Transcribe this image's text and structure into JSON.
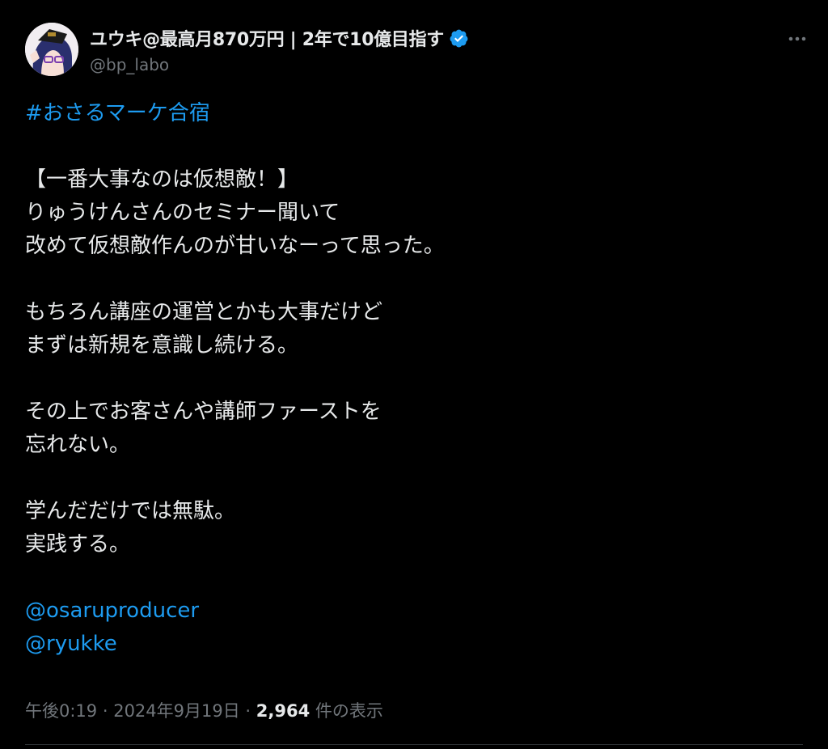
{
  "author": {
    "display_name": "ユウキ@最高月870万円 | 2年で10億目指す",
    "handle": "@bp_labo",
    "verified_icon": "verified-badge-icon",
    "verified_color": "#1d9bf0"
  },
  "menu": {
    "more_icon": "more-options-icon"
  },
  "tweet": {
    "hashtag": "#おさるマーケ合宿",
    "lines": [
      "【一番大事なのは仮想敵！】",
      "りゅうけんさんのセミナー聞いて",
      "改めて仮想敵作んのが甘いなーって思った。",
      "もちろん講座の運営とかも大事だけど",
      "まずは新規を意識し続ける。",
      "その上でお客さんや講師ファーストを",
      "忘れない。",
      "学んだだけでは無駄。",
      "実践する。"
    ],
    "mentions": [
      "@osaruproducer",
      "@ryukke"
    ]
  },
  "meta": {
    "time": "午後0:19",
    "separator1": " · ",
    "date": "2024年9月19日",
    "separator2": " · ",
    "views_count": "2,964",
    "views_label": " 件の表示"
  },
  "colors": {
    "background": "#000000",
    "text": "#e7e9ea",
    "secondary": "#71767b",
    "link": "#1d9bf0"
  }
}
